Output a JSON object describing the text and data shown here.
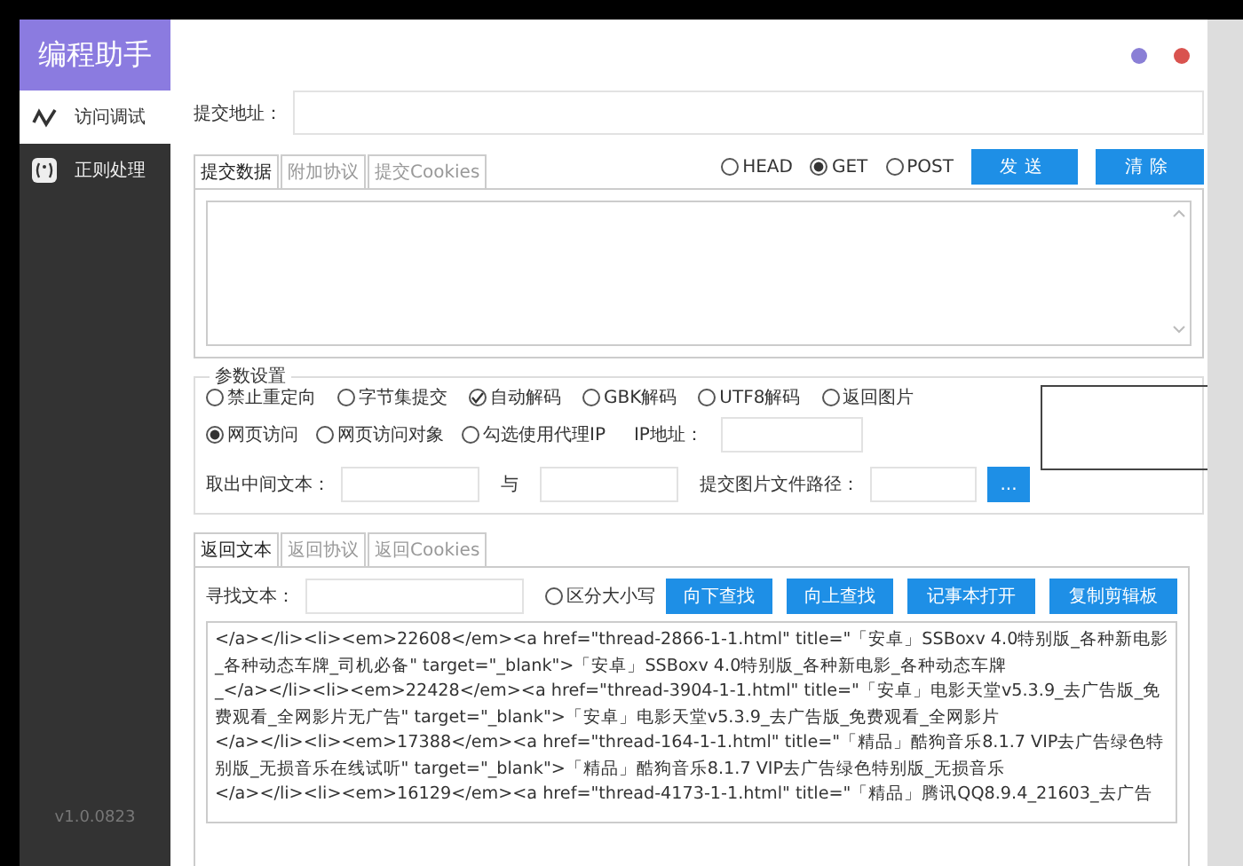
{
  "app": {
    "title": "编程助手",
    "version": "v1.0.0823"
  },
  "nav": [
    {
      "label": "访问调试",
      "kind": "wave",
      "selected": true
    },
    {
      "label": "正则处理",
      "kind": "regex",
      "selected": false
    }
  ],
  "window_dots": [
    {
      "color": "#8a7fd6"
    },
    {
      "color": "#d9534f"
    }
  ],
  "address": {
    "label": "提交地址："
  },
  "request_tabs": [
    {
      "label": "提交数据",
      "selected": true
    },
    {
      "label": "附加协议",
      "selected": false
    },
    {
      "label": "提交Cookies",
      "selected": false
    }
  ],
  "methods": [
    {
      "label": "HEAD",
      "selected": false
    },
    {
      "label": "GET",
      "selected": true
    },
    {
      "label": "POST",
      "selected": false
    }
  ],
  "actions": [
    "发送",
    "清除"
  ],
  "params": {
    "title": "参数设置",
    "row1": [
      {
        "label": "禁止重定向",
        "kind": "check",
        "checked": false
      },
      {
        "label": "字节集提交",
        "kind": "check",
        "checked": false
      },
      {
        "label": "自动解码",
        "kind": "check",
        "checked": true
      },
      {
        "label": "GBK解码",
        "kind": "check",
        "checked": false
      },
      {
        "label": "UTF8解码",
        "kind": "check",
        "checked": false
      },
      {
        "label": "返回图片",
        "kind": "check",
        "checked": false
      }
    ],
    "row2": [
      {
        "label": "网页访问",
        "kind": "radio",
        "checked": true
      },
      {
        "label": "网页访问对象",
        "kind": "radio",
        "checked": false
      },
      {
        "label": "勾选使用代理IP",
        "kind": "check",
        "checked": false
      }
    ],
    "ip_label": "IP地址：",
    "extract_label": "取出中间文本：",
    "and_label": "与",
    "image_path_label": "提交图片文件路径：",
    "browse_button": "..."
  },
  "response_tabs": [
    {
      "label": "返回文本",
      "selected": true
    },
    {
      "label": "返回协议",
      "selected": false
    },
    {
      "label": "返回Cookies",
      "selected": false
    }
  ],
  "search": {
    "label": "寻找文本：",
    "case_label": "区分大小写",
    "case_checked": false
  },
  "search_buttons": [
    "向下查找",
    "向上查找",
    "记事本打开",
    "复制剪辑板"
  ],
  "response_lines": [
    "</a></li><li><em>22608</em><a href=\"thread-2866-1-1.html\" title=\"「安卓」SSBoxv 4.0特别版_各种新电影",
    "_各种动态车牌_司机必备\" target=\"_blank\">「安卓」SSBoxv 4.0特别版_各种新电影_各种动态车牌",
    "_</a></li><li><em>22428</em><a href=\"thread-3904-1-1.html\" title=\"「安卓」电影天堂v5.3.9_去广告版_免",
    "费观看_全网影片无广告\" target=\"_blank\">「安卓」电影天堂v5.3.9_去广告版_免费观看_全网影片",
    "</a></li><li><em>17388</em><a href=\"thread-164-1-1.html\" title=\"「精品」酷狗音乐8.1.7 VIP去广告绿色特",
    "别版_无损音乐在线试听\" target=\"_blank\">「精品」酷狗音乐8.1.7 VIP去广告绿色特别版_无损音乐",
    "</a></li><li><em>16129</em><a href=\"thread-4173-1-1.html\" title=\"「精品」腾讯QQ8.9.4_21603_去广告"
  ]
}
